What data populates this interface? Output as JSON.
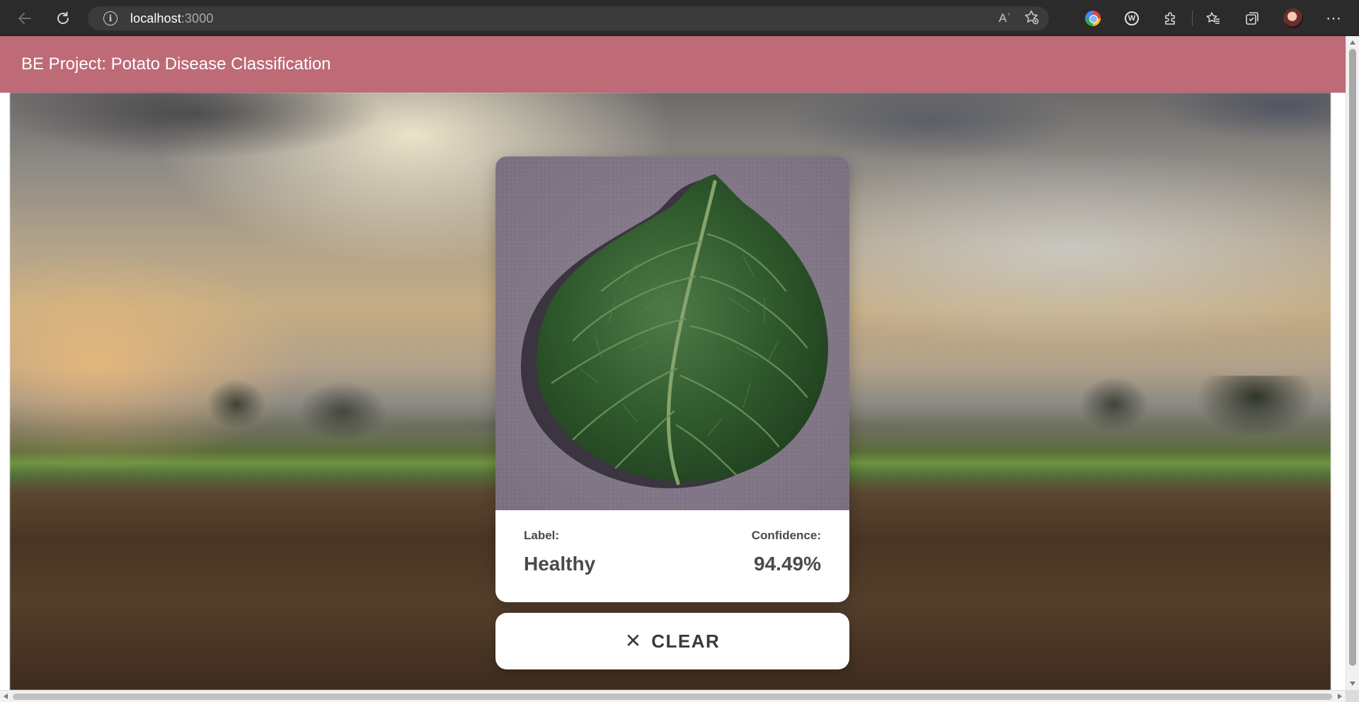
{
  "browser": {
    "url_host": "localhost",
    "url_port": ":3000",
    "icons": {
      "back": "back-arrow-icon",
      "refresh": "refresh-icon",
      "site_info": "info-icon",
      "read_aloud": "read-aloud-icon",
      "add_favorite": "add-favorite-icon",
      "extension_color": "color-picker-extension-icon",
      "extension_w": "w-extension-icon",
      "extensions": "extensions-puzzle-icon",
      "favorites": "favorites-icon",
      "collections": "collections-icon",
      "profile": "profile-avatar",
      "more": "more-options-icon"
    },
    "info_glyph": "i",
    "read_aloud_glyph": "Aʾ",
    "w_glyph": "W",
    "more_glyph": "⋯"
  },
  "app": {
    "title": "BE Project: Potato Disease Classification",
    "header_color": "#be6a77"
  },
  "result": {
    "label_caption": "Label:",
    "label_value": "Healthy",
    "confidence_caption": "Confidence:",
    "confidence_value": "94.49%"
  },
  "actions": {
    "clear_icon": "✕",
    "clear_label": "CLEAR"
  }
}
